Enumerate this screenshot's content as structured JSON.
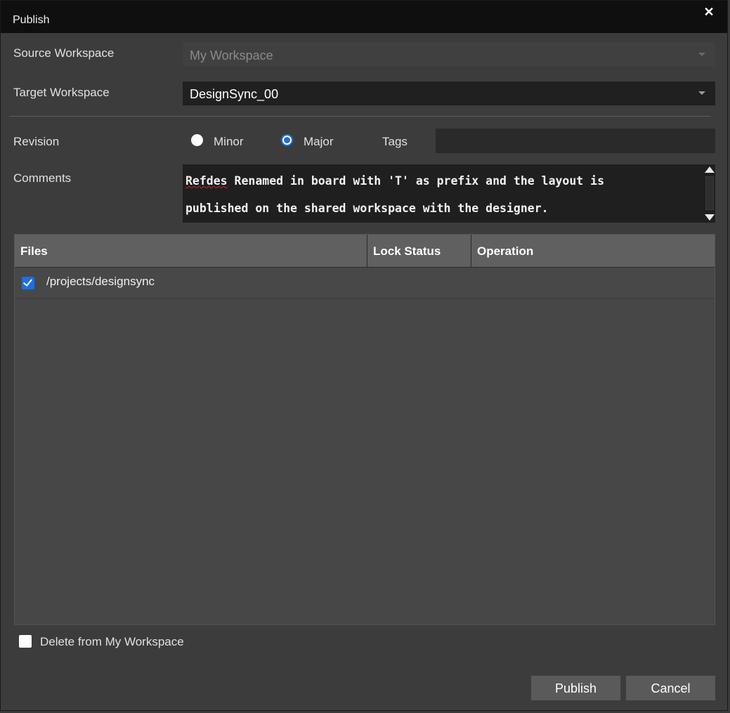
{
  "window": {
    "title": "Publish",
    "close_glyph": "✕"
  },
  "source": {
    "label": "Source Workspace",
    "value": "My Workspace"
  },
  "target": {
    "label": "Target Workspace",
    "value": "DesignSync_00"
  },
  "revision": {
    "label": "Revision",
    "options": [
      {
        "label": "Minor",
        "selected": false
      },
      {
        "label": "Major",
        "selected": true
      }
    ]
  },
  "tags": {
    "label": "Tags",
    "value": ""
  },
  "comments": {
    "label": "Comments",
    "misspelled_word": "Refdes",
    "rest_line1": " Renamed in board with 'T' as prefix and the layout is",
    "line2": "published on the shared workspace with the designer."
  },
  "table": {
    "columns": [
      "Files",
      "Lock Status",
      "Operation"
    ],
    "rows": [
      {
        "checked": true,
        "file": "/projects/designsync",
        "lock_status": "",
        "operation": ""
      }
    ]
  },
  "delete_option": {
    "label": "Delete from My Workspace",
    "checked": false
  },
  "buttons": {
    "publish": "Publish",
    "cancel": "Cancel"
  },
  "colors": {
    "accent": "#1d6fe0",
    "title_bar": "#0f0f0f",
    "background": "#3c3c3c"
  }
}
